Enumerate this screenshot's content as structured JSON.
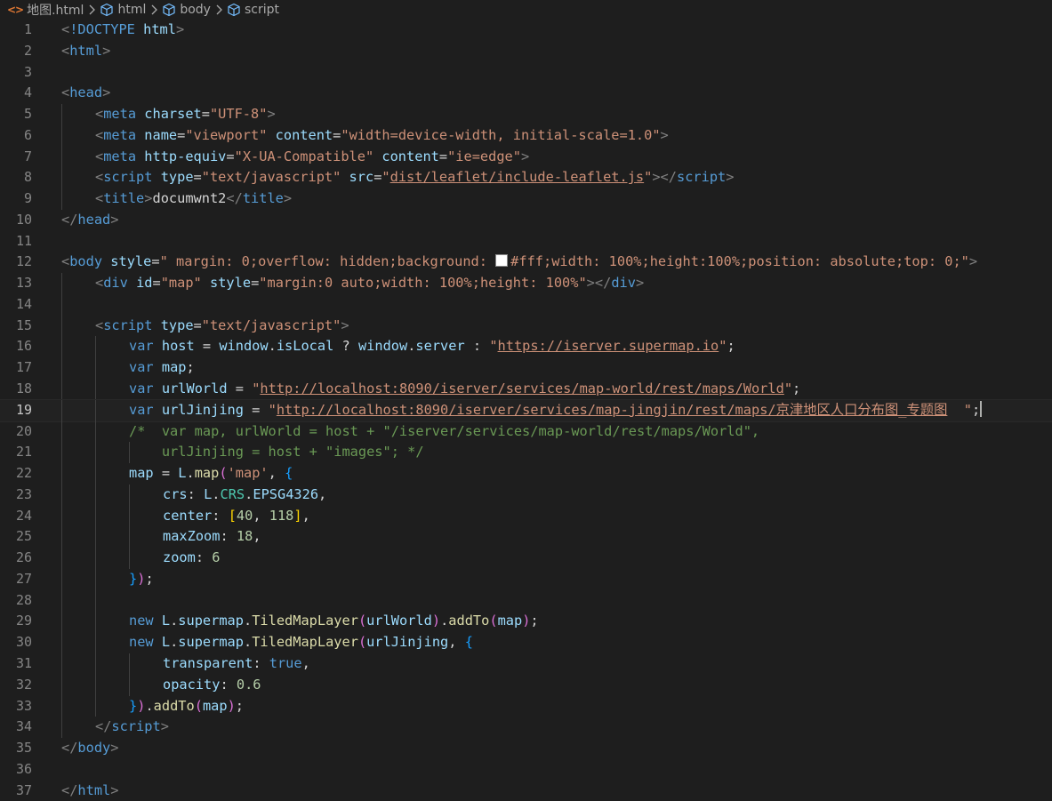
{
  "breadcrumb": {
    "file": "地图.html",
    "items": [
      "html",
      "body",
      "script"
    ]
  },
  "editor": {
    "current_line": 19,
    "lines": [
      {
        "n": "1",
        "tokens": [
          [
            "punct",
            "<"
          ],
          [
            "tag",
            "!DOCTYPE"
          ],
          [
            "text",
            " "
          ],
          [
            "attr",
            "html"
          ],
          [
            "punct",
            ">"
          ]
        ]
      },
      {
        "n": "2",
        "tokens": [
          [
            "punct",
            "<"
          ],
          [
            "tag",
            "html"
          ],
          [
            "punct",
            ">"
          ]
        ]
      },
      {
        "n": "3",
        "tokens": []
      },
      {
        "n": "4",
        "tokens": [
          [
            "punct",
            "<"
          ],
          [
            "tag",
            "head"
          ],
          [
            "punct",
            ">"
          ]
        ]
      },
      {
        "n": "5",
        "tokens": [
          [
            "punct",
            "<"
          ],
          [
            "tag",
            "meta"
          ],
          [
            "text",
            " "
          ],
          [
            "attr",
            "charset"
          ],
          [
            "text",
            "="
          ],
          [
            "str",
            "\"UTF-8\""
          ],
          [
            "punct",
            ">"
          ]
        ]
      },
      {
        "n": "6",
        "tokens": [
          [
            "punct",
            "<"
          ],
          [
            "tag",
            "meta"
          ],
          [
            "text",
            " "
          ],
          [
            "attr",
            "name"
          ],
          [
            "text",
            "="
          ],
          [
            "str",
            "\"viewport\""
          ],
          [
            "text",
            " "
          ],
          [
            "attr",
            "content"
          ],
          [
            "text",
            "="
          ],
          [
            "str",
            "\"width=device-width, initial-scale=1.0\""
          ],
          [
            "punct",
            ">"
          ]
        ]
      },
      {
        "n": "7",
        "tokens": [
          [
            "punct",
            "<"
          ],
          [
            "tag",
            "meta"
          ],
          [
            "text",
            " "
          ],
          [
            "attr",
            "http-equiv"
          ],
          [
            "text",
            "="
          ],
          [
            "str",
            "\"X-UA-Compatible\""
          ],
          [
            "text",
            " "
          ],
          [
            "attr",
            "content"
          ],
          [
            "text",
            "="
          ],
          [
            "str",
            "\"ie=edge\""
          ],
          [
            "punct",
            ">"
          ]
        ]
      },
      {
        "n": "8",
        "tokens": [
          [
            "punct",
            "<"
          ],
          [
            "tag",
            "script"
          ],
          [
            "text",
            " "
          ],
          [
            "attr",
            "type"
          ],
          [
            "text",
            "="
          ],
          [
            "str",
            "\"text/javascript\""
          ],
          [
            "text",
            " "
          ],
          [
            "attr",
            "src"
          ],
          [
            "text",
            "="
          ],
          [
            "str",
            "\""
          ],
          [
            "link",
            "dist/leaflet/include-leaflet.js"
          ],
          [
            "str",
            "\""
          ],
          [
            "punct",
            "></"
          ],
          [
            "tag",
            "script"
          ],
          [
            "punct",
            ">"
          ]
        ]
      },
      {
        "n": "9",
        "tokens": [
          [
            "punct",
            "<"
          ],
          [
            "tag",
            "title"
          ],
          [
            "punct",
            ">"
          ],
          [
            "text",
            "documwnt2"
          ],
          [
            "punct",
            "</"
          ],
          [
            "tag",
            "title"
          ],
          [
            "punct",
            ">"
          ]
        ]
      },
      {
        "n": "10",
        "tokens": [
          [
            "punct",
            "</"
          ],
          [
            "tag",
            "head"
          ],
          [
            "punct",
            ">"
          ]
        ]
      },
      {
        "n": "11",
        "tokens": []
      },
      {
        "n": "12",
        "tokens": [
          [
            "punct",
            "<"
          ],
          [
            "tag",
            "body"
          ],
          [
            "text",
            " "
          ],
          [
            "attr",
            "style"
          ],
          [
            "text",
            "="
          ],
          [
            "str",
            "\" margin: 0;overflow: hidden;background: "
          ],
          [
            "swatch",
            "#ffffff"
          ],
          [
            "str",
            "#fff;width: 100%;height:100%;position: absolute;top: 0;\""
          ],
          [
            "punct",
            ">"
          ]
        ]
      },
      {
        "n": "13",
        "tokens": [
          [
            "punct",
            "<"
          ],
          [
            "tag",
            "div"
          ],
          [
            "text",
            " "
          ],
          [
            "attr",
            "id"
          ],
          [
            "text",
            "="
          ],
          [
            "str",
            "\"map\""
          ],
          [
            "text",
            " "
          ],
          [
            "attr",
            "style"
          ],
          [
            "text",
            "="
          ],
          [
            "str",
            "\"margin:0 auto;width: 100%;height: 100%\""
          ],
          [
            "punct",
            "></"
          ],
          [
            "tag",
            "div"
          ],
          [
            "punct",
            ">"
          ]
        ]
      },
      {
        "n": "14",
        "tokens": []
      },
      {
        "n": "15",
        "tokens": [
          [
            "punct",
            "<"
          ],
          [
            "tag",
            "script"
          ],
          [
            "text",
            " "
          ],
          [
            "attr",
            "type"
          ],
          [
            "text",
            "="
          ],
          [
            "str",
            "\"text/javascript\""
          ],
          [
            "punct",
            ">"
          ]
        ]
      },
      {
        "n": "16",
        "tokens": [
          [
            "kw",
            "var"
          ],
          [
            "text",
            " "
          ],
          [
            "var",
            "host"
          ],
          [
            "text",
            " = "
          ],
          [
            "var",
            "window"
          ],
          [
            "text",
            "."
          ],
          [
            "var",
            "isLocal"
          ],
          [
            "text",
            " ? "
          ],
          [
            "var",
            "window"
          ],
          [
            "text",
            "."
          ],
          [
            "var",
            "server"
          ],
          [
            "text",
            " : "
          ],
          [
            "str",
            "\""
          ],
          [
            "link",
            "https://iserver.supermap.io"
          ],
          [
            "str",
            "\""
          ],
          [
            "text",
            ";"
          ]
        ]
      },
      {
        "n": "17",
        "tokens": [
          [
            "kw",
            "var"
          ],
          [
            "text",
            " "
          ],
          [
            "var",
            "map"
          ],
          [
            "text",
            ";"
          ]
        ]
      },
      {
        "n": "18",
        "tokens": [
          [
            "kw",
            "var"
          ],
          [
            "text",
            " "
          ],
          [
            "var",
            "urlWorld"
          ],
          [
            "text",
            " = "
          ],
          [
            "str",
            "\""
          ],
          [
            "link",
            "http://localhost:8090/iserver/services/map-world/rest/maps/World"
          ],
          [
            "str",
            "\""
          ],
          [
            "text",
            ";"
          ]
        ]
      },
      {
        "n": "19",
        "tokens": [
          [
            "kw",
            "var"
          ],
          [
            "text",
            " "
          ],
          [
            "var",
            "urlJinjing"
          ],
          [
            "text",
            " = "
          ],
          [
            "str",
            "\""
          ],
          [
            "link",
            "http://localhost:8090/iserver/services/map-jingjin/rest/maps/京津地区人口分布图_专题图"
          ],
          [
            "str",
            "  \""
          ],
          [
            "text",
            ";"
          ],
          [
            "cursor",
            ""
          ]
        ]
      },
      {
        "n": "20",
        "tokens": [
          [
            "comment",
            "/*  var map, urlWorld = host + \"/iserver/services/map-world/rest/maps/World\","
          ]
        ]
      },
      {
        "n": "21",
        "tokens": [
          [
            "comment",
            "    urlJinjing = host + \"images\"; */"
          ]
        ]
      },
      {
        "n": "22",
        "tokens": [
          [
            "var",
            "map"
          ],
          [
            "text",
            " = "
          ],
          [
            "var",
            "L"
          ],
          [
            "text",
            "."
          ],
          [
            "fn",
            "map"
          ],
          [
            "br1",
            "("
          ],
          [
            "str",
            "'map'"
          ],
          [
            "text",
            ", "
          ],
          [
            "br2",
            "{"
          ]
        ]
      },
      {
        "n": "23",
        "tokens": [
          [
            "prop",
            "crs"
          ],
          [
            "text",
            ": "
          ],
          [
            "var",
            "L"
          ],
          [
            "text",
            "."
          ],
          [
            "cls",
            "CRS"
          ],
          [
            "text",
            "."
          ],
          [
            "var",
            "EPSG4326"
          ],
          [
            "text",
            ","
          ]
        ]
      },
      {
        "n": "24",
        "tokens": [
          [
            "prop",
            "center"
          ],
          [
            "text",
            ": "
          ],
          [
            "br3",
            "["
          ],
          [
            "num",
            "40"
          ],
          [
            "text",
            ", "
          ],
          [
            "num",
            "118"
          ],
          [
            "br3",
            "]"
          ],
          [
            "text",
            ","
          ]
        ]
      },
      {
        "n": "25",
        "tokens": [
          [
            "prop",
            "maxZoom"
          ],
          [
            "text",
            ": "
          ],
          [
            "num",
            "18"
          ],
          [
            "text",
            ","
          ]
        ]
      },
      {
        "n": "26",
        "tokens": [
          [
            "prop",
            "zoom"
          ],
          [
            "text",
            ": "
          ],
          [
            "num",
            "6"
          ]
        ]
      },
      {
        "n": "27",
        "tokens": [
          [
            "br2",
            "}"
          ],
          [
            "br1",
            ")"
          ],
          [
            "text",
            ";"
          ]
        ]
      },
      {
        "n": "28",
        "tokens": []
      },
      {
        "n": "29",
        "tokens": [
          [
            "kw",
            "new"
          ],
          [
            "text",
            " "
          ],
          [
            "var",
            "L"
          ],
          [
            "text",
            "."
          ],
          [
            "var",
            "supermap"
          ],
          [
            "text",
            "."
          ],
          [
            "fn",
            "TiledMapLayer"
          ],
          [
            "br1",
            "("
          ],
          [
            "var",
            "urlWorld"
          ],
          [
            "br1",
            ")"
          ],
          [
            "text",
            "."
          ],
          [
            "fn",
            "addTo"
          ],
          [
            "br1",
            "("
          ],
          [
            "var",
            "map"
          ],
          [
            "br1",
            ")"
          ],
          [
            "text",
            ";"
          ]
        ]
      },
      {
        "n": "30",
        "tokens": [
          [
            "kw",
            "new"
          ],
          [
            "text",
            " "
          ],
          [
            "var",
            "L"
          ],
          [
            "text",
            "."
          ],
          [
            "var",
            "supermap"
          ],
          [
            "text",
            "."
          ],
          [
            "fn",
            "TiledMapLayer"
          ],
          [
            "br1",
            "("
          ],
          [
            "var",
            "urlJinjing"
          ],
          [
            "text",
            ", "
          ],
          [
            "br2",
            "{"
          ]
        ]
      },
      {
        "n": "31",
        "tokens": [
          [
            "prop",
            "transparent"
          ],
          [
            "text",
            ": "
          ],
          [
            "kw",
            "true"
          ],
          [
            "text",
            ","
          ]
        ]
      },
      {
        "n": "32",
        "tokens": [
          [
            "prop",
            "opacity"
          ],
          [
            "text",
            ": "
          ],
          [
            "num",
            "0.6"
          ]
        ]
      },
      {
        "n": "33",
        "tokens": [
          [
            "br2",
            "}"
          ],
          [
            "br1",
            ")"
          ],
          [
            "text",
            "."
          ],
          [
            "fn",
            "addTo"
          ],
          [
            "br1",
            "("
          ],
          [
            "var",
            "map"
          ],
          [
            "br1",
            ")"
          ],
          [
            "text",
            ";"
          ]
        ]
      },
      {
        "n": "34",
        "tokens": [
          [
            "punct",
            "</"
          ],
          [
            "tag",
            "script"
          ],
          [
            "punct",
            ">"
          ]
        ]
      },
      {
        "n": "35",
        "tokens": [
          [
            "punct",
            "</"
          ],
          [
            "tag",
            "body"
          ],
          [
            "punct",
            ">"
          ]
        ]
      },
      {
        "n": "36",
        "tokens": []
      },
      {
        "n": "37",
        "tokens": [
          [
            "punct",
            "</"
          ],
          [
            "tag",
            "html"
          ],
          [
            "punct",
            ">"
          ]
        ]
      }
    ]
  }
}
